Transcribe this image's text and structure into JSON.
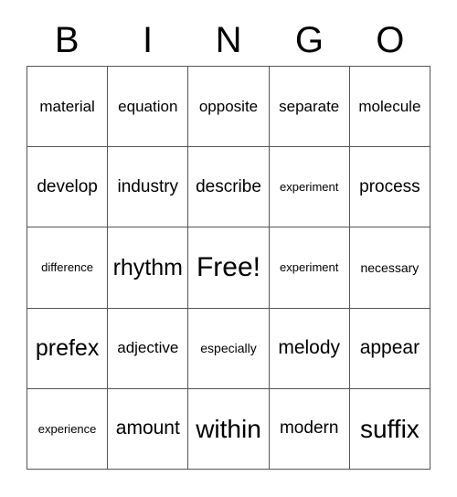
{
  "header": {
    "letters": [
      "B",
      "I",
      "N",
      "G",
      "O"
    ]
  },
  "grid": {
    "rows": 5,
    "columns": 5,
    "border_color": "#555555",
    "background_color": "#ffffff",
    "text_color": "#000000",
    "cells": [
      [
        {
          "text": "material",
          "size": "m"
        },
        {
          "text": "equation",
          "size": "m"
        },
        {
          "text": "opposite",
          "size": "m"
        },
        {
          "text": "separate",
          "size": "m"
        },
        {
          "text": "molecule",
          "size": "m"
        }
      ],
      [
        {
          "text": "develop",
          "size": "l"
        },
        {
          "text": "industry",
          "size": "l"
        },
        {
          "text": "describe",
          "size": "l"
        },
        {
          "text": "experiment",
          "size": "xs"
        },
        {
          "text": "process",
          "size": "l"
        }
      ],
      [
        {
          "text": "difference",
          "size": "xs"
        },
        {
          "text": "rhythm",
          "size": "xxl"
        },
        {
          "text": "Free!",
          "size": "free"
        },
        {
          "text": "experiment",
          "size": "xs"
        },
        {
          "text": "necessary",
          "size": "s"
        }
      ],
      [
        {
          "text": "prefex",
          "size": "xxl"
        },
        {
          "text": "adjective",
          "size": "m"
        },
        {
          "text": "especially",
          "size": "s"
        },
        {
          "text": "melody",
          "size": "xl"
        },
        {
          "text": "appear",
          "size": "xl"
        }
      ],
      [
        {
          "text": "experience",
          "size": "xs"
        },
        {
          "text": "amount",
          "size": "xl"
        },
        {
          "text": "within",
          "size": "huge"
        },
        {
          "text": "modern",
          "size": "l"
        },
        {
          "text": "suffix",
          "size": "huge"
        }
      ]
    ]
  }
}
